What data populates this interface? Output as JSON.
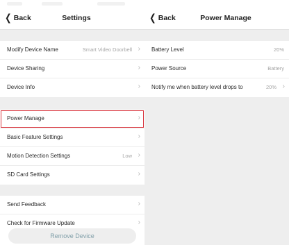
{
  "settings_screen": {
    "back_label": "Back",
    "title": "Settings",
    "groups": [
      {
        "items": [
          {
            "label": "Modify Device Name",
            "value": "Smart  Video Doorbell"
          },
          {
            "label": "Device Sharing",
            "value": ""
          },
          {
            "label": "Device Info",
            "value": ""
          }
        ]
      },
      {
        "items": [
          {
            "label": "Power Manage",
            "value": ""
          },
          {
            "label": "Basic Feature Settings",
            "value": ""
          },
          {
            "label": "Motion Detection Settings",
            "value": "Low"
          },
          {
            "label": "SD Card Settings",
            "value": ""
          }
        ]
      },
      {
        "items": [
          {
            "label": "Send Feedback",
            "value": ""
          },
          {
            "label": "Check for Firmware Update",
            "value": ""
          }
        ]
      }
    ],
    "remove_button_label": "Remove Device"
  },
  "power_screen": {
    "back_label": "Back",
    "title": "Power Manage",
    "items": [
      {
        "label": "Battery Level",
        "value": "20%"
      },
      {
        "label": "Power Source",
        "value": "Battery"
      },
      {
        "label": "Notify me when battery level drops to",
        "value": "20%"
      }
    ]
  },
  "icons": {
    "back": "chevron-left-icon",
    "row_arrow": "chevron-right-icon"
  },
  "colors": {
    "highlight_border": "#d9343d",
    "background": "#eeeeee",
    "remove_text": "#7f9ea8"
  }
}
